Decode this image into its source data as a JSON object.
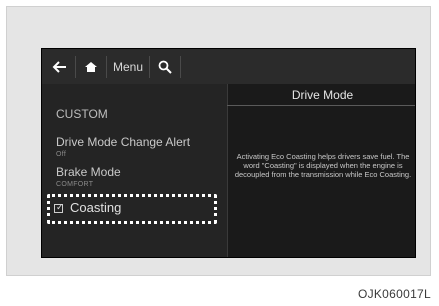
{
  "toolbar": {
    "back_icon": "back-arrow-icon",
    "home_icon": "home-icon",
    "menu_label": "Menu",
    "search_icon": "search-icon"
  },
  "panel": {
    "title": "Drive Mode"
  },
  "settings": {
    "section": "CUSTOM",
    "items": [
      {
        "label": "Drive Mode Change Alert",
        "value": "Off"
      },
      {
        "label": "Brake Mode",
        "value": "COMFORT"
      },
      {
        "label": "Coasting",
        "checked": true
      }
    ]
  },
  "description": "Activating Eco Coasting helps drivers save fuel. The word \"Coasting\" is displayed when the engine is decoupled from the transmission while Eco Coasting.",
  "caption": "OJK060017L",
  "colors": {
    "screen_bg": "#1c1c1c",
    "highlight_border": "#ffffff"
  }
}
